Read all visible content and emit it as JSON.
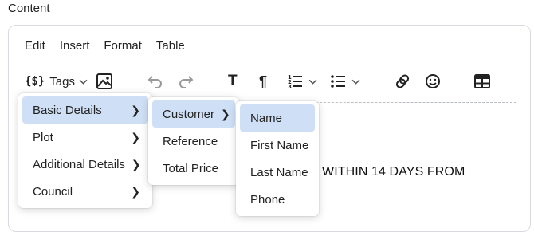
{
  "field_label": "Content",
  "menubar": [
    "Edit",
    "Insert",
    "Format",
    "Table"
  ],
  "toolbar": {
    "tags_label": "Tags",
    "icons": [
      "tags-icon",
      "image-icon",
      "undo-icon",
      "redo-icon",
      "text-format-icon",
      "paragraph-icon",
      "numbered-list-icon",
      "bullet-list-icon",
      "link-icon",
      "emoji-icon",
      "table-icon"
    ]
  },
  "document": {
    "visible_text": "WITHIN 14 DAYS FROM"
  },
  "menus": {
    "level1": [
      {
        "label": "Basic Details",
        "submenu": true,
        "active": true
      },
      {
        "label": "Plot",
        "submenu": true
      },
      {
        "label": "Additional Details",
        "submenu": true
      },
      {
        "label": "Council",
        "submenu": true
      }
    ],
    "level2": [
      {
        "label": "Customer",
        "submenu": true,
        "active": true
      },
      {
        "label": "Reference"
      },
      {
        "label": "Total Price"
      }
    ],
    "level3": [
      {
        "label": "Name",
        "active": true
      },
      {
        "label": "First Name"
      },
      {
        "label": "Last Name"
      },
      {
        "label": "Phone"
      }
    ]
  },
  "colors": {
    "active_item_bg": "#cfe0f6",
    "border": "#d7dbe0"
  }
}
